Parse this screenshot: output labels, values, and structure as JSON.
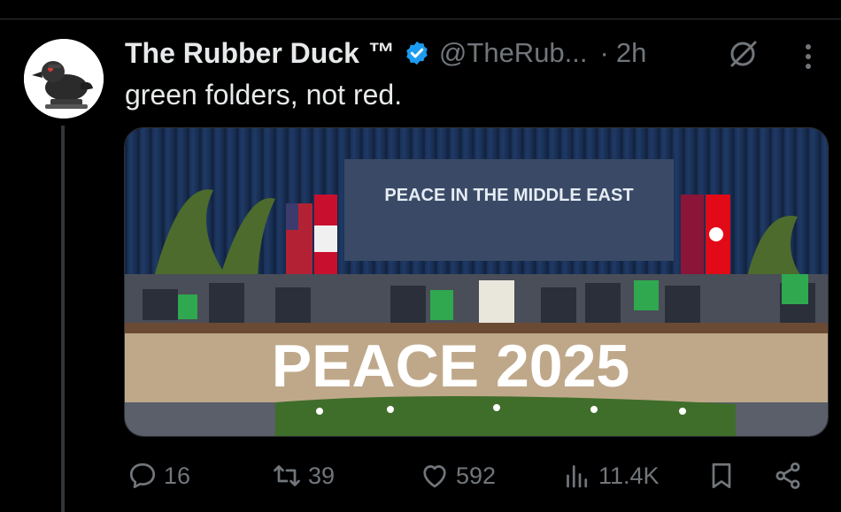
{
  "tweet": {
    "display_name": "The Rubber Duck",
    "trademark": "™",
    "handle": "@TheRub...",
    "separator": "·",
    "time": "2h",
    "text": "green folders, not red.",
    "media": {
      "banner_text": "PEACE IN THE MIDDLE EAST",
      "stage_text": "PEACE 2025"
    },
    "actions": {
      "replies": "16",
      "reposts": "39",
      "likes": "592",
      "views": "11.4K"
    }
  },
  "colors": {
    "background": "#000000",
    "primary_text": "#e7e9ea",
    "secondary_text": "#71767b",
    "verified_badge": "#1d9bf0",
    "divider": "#2f3336"
  },
  "icons": [
    "verified-badge-icon",
    "grok-icon",
    "more-icon",
    "reply-icon",
    "repost-icon",
    "like-icon",
    "views-icon",
    "bookmark-icon",
    "share-icon"
  ]
}
